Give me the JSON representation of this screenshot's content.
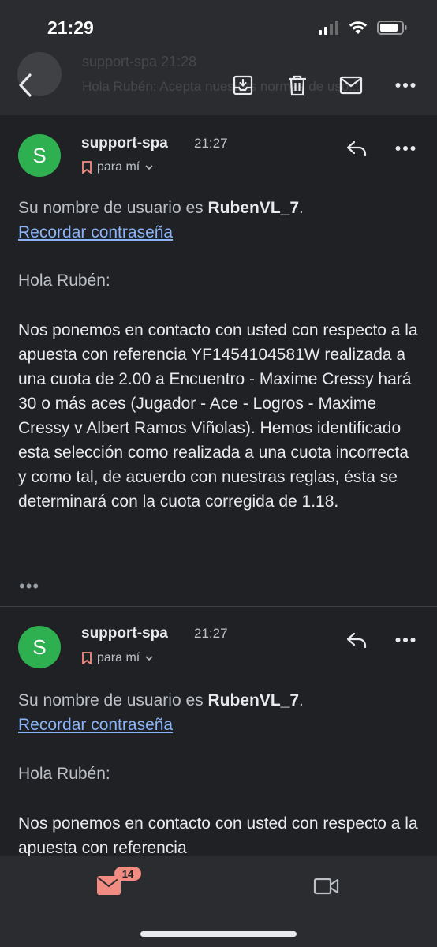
{
  "status_bar": {
    "time": "21:29"
  },
  "background_preview": {
    "sender": "support-spa  21:28",
    "snippet": "Hola Rubén: Acepta nuestras normas de uso..."
  },
  "colors": {
    "background": "#202124",
    "bar": "#2b2c2f",
    "avatar": "#2eb051",
    "link": "#8ab4f8",
    "badge": "#f28b82"
  },
  "messages": [
    {
      "avatar_letter": "S",
      "sender": "support-spa",
      "time": "21:27",
      "recipient": "para mí",
      "username_prefix": "Su nombre de usuario es ",
      "username": "RubenVL_7",
      "username_suffix": ".",
      "link": "Recordar contraseña",
      "greeting": "Hola Rubén:",
      "body": "Nos ponemos en contacto con usted con respecto a la apuesta con referencia YF1454104581W realizada a una cuota de 2.00 a Encuentro - Maxime Cressy hará 30 o más aces (Jugador - Ace - Logros - Maxime Cressy v Albert Ramos Viñolas). Hemos identificado esta selección como realizada a una cuota incorrecta y como tal, de acuerdo con nuestras reglas, ésta se determinará con la cuota corregida de 1.18.",
      "more": "•••"
    },
    {
      "avatar_letter": "S",
      "sender": "support-spa",
      "time": "21:27",
      "recipient": "para mí",
      "username_prefix": "Su nombre de usuario es ",
      "username": "RubenVL_7",
      "username_suffix": ".",
      "link": "Recordar contraseña",
      "greeting": "Hola Rubén:",
      "body": "Nos ponemos en contacto con usted con respecto a la apuesta con referencia"
    }
  ],
  "bottom_nav": {
    "mail_badge": "14"
  },
  "icons": [
    "back-icon",
    "archive-icon",
    "trash-icon",
    "mail-icon",
    "more-vert-icon",
    "reply-icon",
    "label-icon",
    "chevron-down-icon",
    "video-icon"
  ]
}
